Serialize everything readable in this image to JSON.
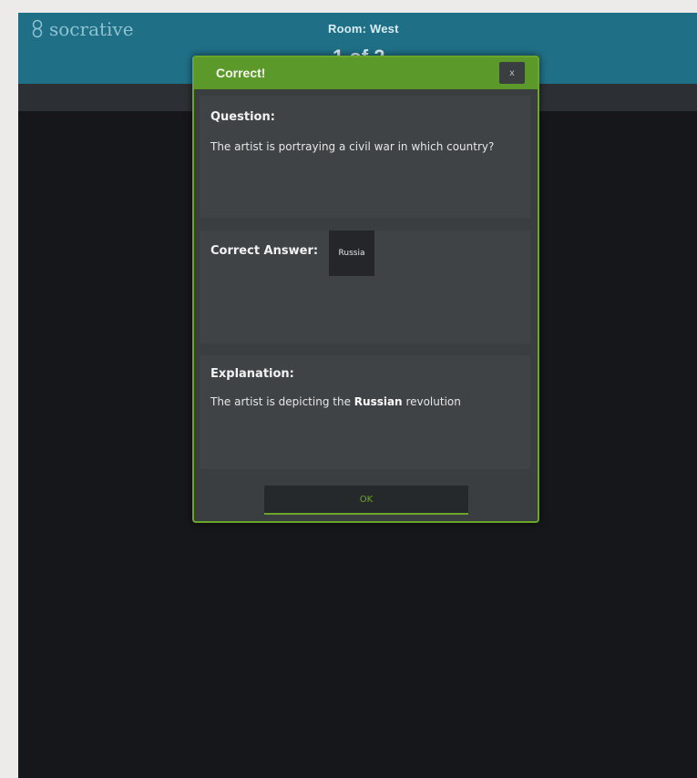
{
  "app": {
    "logo_text": "socrative",
    "room_label": "Room: West",
    "progress_text": "1 of 2"
  },
  "modal": {
    "title": "Correct!",
    "close_label": "x",
    "question_label": "Question:",
    "question_text": "The artist is portraying a civil war in which country?",
    "answer_label": "Correct Answer:",
    "answer_value": "Russia",
    "explanation_label": "Explanation:",
    "explanation_before": "The artist is depicting the",
    "explanation_bold": "Russian",
    "explanation_after": "revolution",
    "ok_label": "OK"
  },
  "colors": {
    "topbar": "#1f6f86",
    "accent_green": "#6aa62a",
    "modal_bg": "#3b3e41",
    "app_bg": "#16171a"
  },
  "icons": [
    "socrative-logo-icon",
    "close-icon"
  ]
}
